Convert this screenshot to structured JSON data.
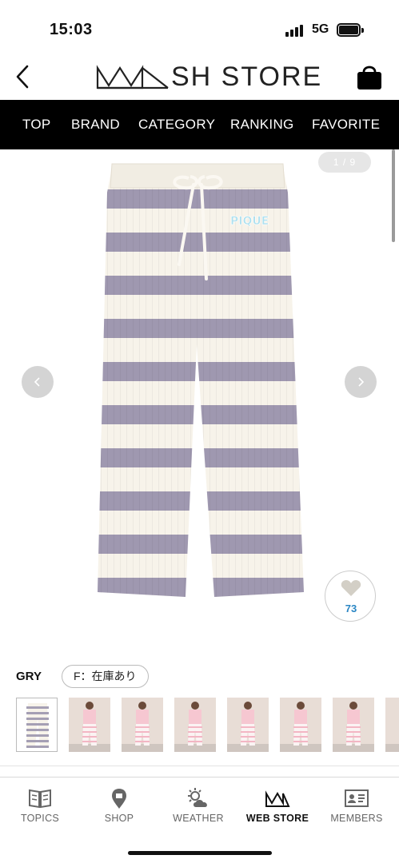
{
  "status_bar": {
    "time": "15:03",
    "network": "5G"
  },
  "header": {
    "logo_text": "SH STORE",
    "logo_full": "MASH STORE",
    "back_icon": "chevron-left-icon",
    "cart_icon": "shopping-bag-icon"
  },
  "nav": {
    "items": [
      {
        "label": "TOP"
      },
      {
        "label": "BRAND"
      },
      {
        "label": "CATEGORY"
      },
      {
        "label": "RANKING"
      },
      {
        "label": "FAVORITE"
      }
    ]
  },
  "gallery": {
    "counter": "1 / 9",
    "current_index": 1,
    "total": 9,
    "product_logo_text": "PIQUE",
    "favorite_count": "73",
    "colors": {
      "stripe_gray": "#9f98b0",
      "stripe_cream": "#f7f3ea",
      "favorite_count": "#2a86c4"
    }
  },
  "variant": {
    "color_code": "GRY",
    "stock_label": "F：在庫あり"
  },
  "thumbnails": [
    {
      "selected": true,
      "color": "gray"
    },
    {
      "selected": false,
      "color": "pink"
    },
    {
      "selected": false,
      "color": "pink"
    },
    {
      "selected": false,
      "color": "pink"
    },
    {
      "selected": false,
      "color": "pink"
    },
    {
      "selected": false,
      "color": "pink"
    },
    {
      "selected": false,
      "color": "pink"
    },
    {
      "selected": false,
      "color": "pink"
    }
  ],
  "tabbar": {
    "items": [
      {
        "label": "TOPICS",
        "icon": "book-icon",
        "active": false
      },
      {
        "label": "SHOP",
        "icon": "location-pin-icon",
        "active": false
      },
      {
        "label": "WEATHER",
        "icon": "sun-cloud-icon",
        "active": false
      },
      {
        "label": "WEB STORE",
        "icon": "web-store-logo-icon",
        "active": true
      },
      {
        "label": "MEMBERS",
        "icon": "member-card-icon",
        "active": false
      }
    ]
  }
}
